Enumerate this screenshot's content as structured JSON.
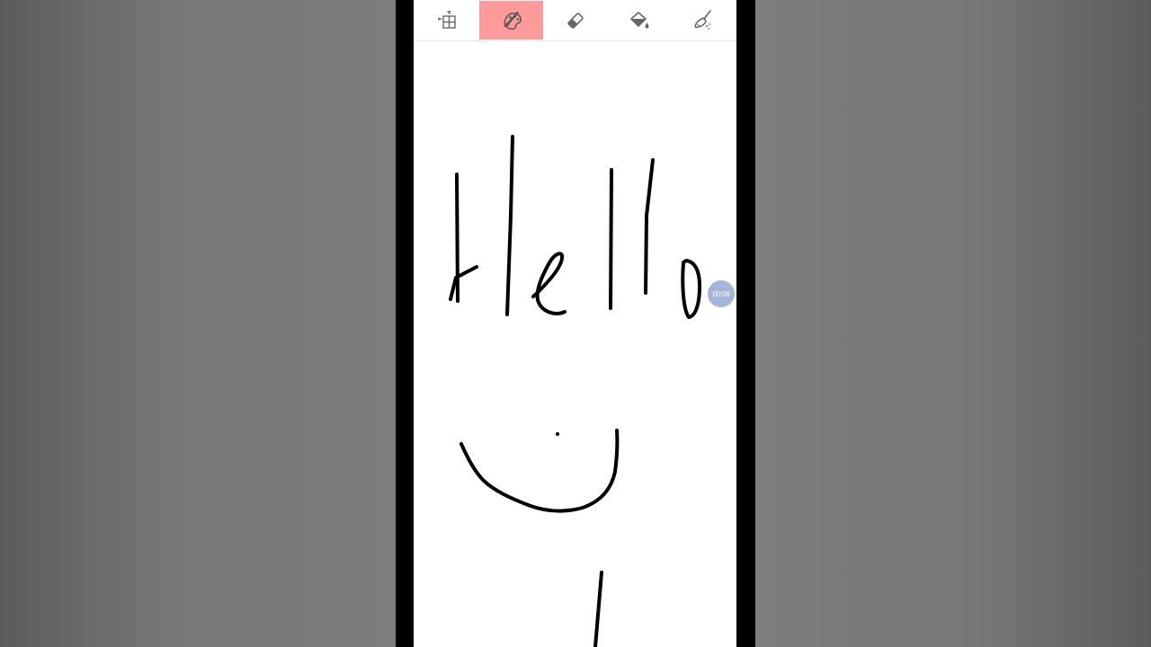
{
  "toolbar": {
    "tools": [
      {
        "name": "layout-tool",
        "icon": "layout-grid-icon",
        "active": false
      },
      {
        "name": "brush-tool",
        "icon": "paint-brush-palette-icon",
        "active": true
      },
      {
        "name": "eraser-tool",
        "icon": "eraser-icon",
        "active": false
      },
      {
        "name": "fill-tool",
        "icon": "paint-bucket-icon",
        "active": false
      },
      {
        "name": "clear-tool",
        "icon": "broom-icon",
        "active": false
      }
    ],
    "active_color": "#ff9a9a",
    "icon_color": "#666666"
  },
  "canvas": {
    "background": "#ffffff",
    "stroke_color": "#000000"
  },
  "recording_timer": {
    "time": "00:06",
    "color": "#9fb0d4"
  }
}
